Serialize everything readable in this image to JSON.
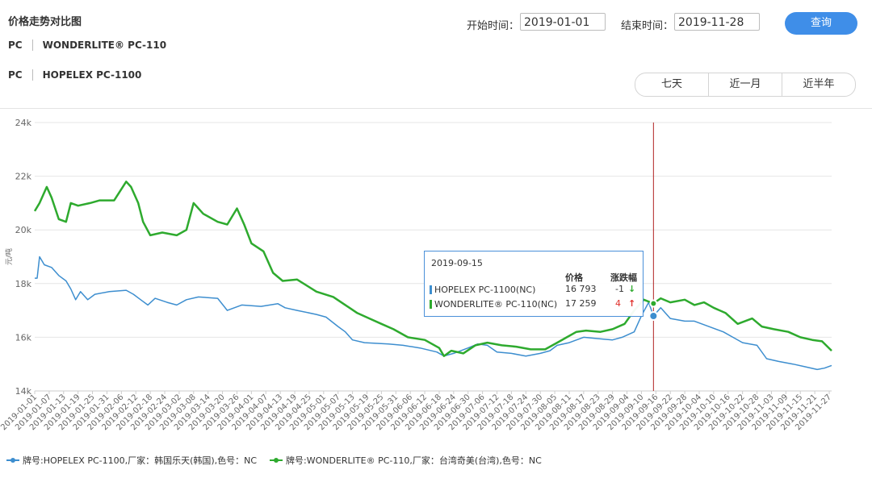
{
  "header": {
    "title": "价格走势对比图",
    "products": [
      {
        "category": "PC",
        "name": "WONDERLITE® PC-110"
      },
      {
        "category": "PC",
        "name": "HOPELEX PC-1100"
      }
    ],
    "start_label": "开始时间：",
    "start_value": "2019-01-01",
    "end_label": "结束时间：",
    "end_value": "2019-11-28",
    "query_label": "查询",
    "ranges": [
      "七天",
      "近一月",
      "近半年"
    ]
  },
  "tooltip": {
    "date": "2019-09-15",
    "col_price": "价格",
    "col_change": "涨跌幅",
    "rows": [
      {
        "name": "HOPELEX PC-1100(NC)",
        "price": "16 793",
        "change": "-1",
        "arrow": "↓"
      },
      {
        "name": "WONDERLITE® PC-110(NC)",
        "price": "17 259",
        "change": "4",
        "arrow": "↑"
      }
    ]
  },
  "legend": [
    "牌号:HOPELEX PC-1100,厂家：韩国乐天(韩国),色号：NC",
    "牌号:WONDERLITE® PC-110,厂家：台湾奇美(台湾),色号：NC"
  ],
  "colors": {
    "blue": "#3d8ecf",
    "green": "#2eaa2e",
    "cursor": "#b22222",
    "button": "#3f8ee8"
  },
  "chart_data": {
    "type": "line",
    "ylabel": "元/吨",
    "ylim": [
      14000,
      24000
    ],
    "yticks": [
      "14k",
      "16k",
      "18k",
      "20k",
      "22k",
      "24k"
    ],
    "xticks": [
      "2019-01-01",
      "2019-01-07",
      "2019-01-13",
      "2019-01-19",
      "2019-01-25",
      "2019-01-31",
      "2019-02-06",
      "2019-02-12",
      "2019-02-18",
      "2019-02-24",
      "2019-03-02",
      "2019-03-08",
      "2019-03-14",
      "2019-03-20",
      "2019-03-26",
      "2019-04-01",
      "2019-04-07",
      "2019-04-13",
      "2019-04-19",
      "2019-04-25",
      "2019-05-01",
      "2019-05-07",
      "2019-05-13",
      "2019-05-19",
      "2019-05-25",
      "2019-05-31",
      "2019-06-06",
      "2019-06-12",
      "2019-06-18",
      "2019-06-24",
      "2019-06-30",
      "2019-07-06",
      "2019-07-12",
      "2019-07-18",
      "2019-07-24",
      "2019-07-30",
      "2019-08-05",
      "2019-08-11",
      "2019-08-17",
      "2019-08-23",
      "2019-08-29",
      "2019-09-04",
      "2019-09-10",
      "2019-09-16",
      "2019-09-22",
      "2019-09-28",
      "2019-10-04",
      "2019-10-10",
      "2019-10-16",
      "2019-10-22",
      "2019-10-28",
      "2019-11-03",
      "2019-11-09",
      "2019-11-15",
      "2019-11-21",
      "2019-11-27"
    ],
    "cursor_date": "2019-09-15",
    "series": [
      {
        "name": "HOPELEX PC-1100",
        "points": [
          [
            "2019-01-01",
            18200
          ],
          [
            "2019-01-02",
            18200
          ],
          [
            "2019-01-03",
            19000
          ],
          [
            "2019-01-05",
            18700
          ],
          [
            "2019-01-08",
            18600
          ],
          [
            "2019-01-11",
            18300
          ],
          [
            "2019-01-14",
            18100
          ],
          [
            "2019-01-16",
            17800
          ],
          [
            "2019-01-18",
            17400
          ],
          [
            "2019-01-20",
            17700
          ],
          [
            "2019-01-23",
            17400
          ],
          [
            "2019-01-26",
            17600
          ],
          [
            "2019-02-01",
            17700
          ],
          [
            "2019-02-08",
            17750
          ],
          [
            "2019-02-11",
            17600
          ],
          [
            "2019-02-14",
            17400
          ],
          [
            "2019-02-17",
            17200
          ],
          [
            "2019-02-20",
            17450
          ],
          [
            "2019-02-25",
            17300
          ],
          [
            "2019-03-01",
            17200
          ],
          [
            "2019-03-05",
            17400
          ],
          [
            "2019-03-10",
            17500
          ],
          [
            "2019-03-18",
            17450
          ],
          [
            "2019-03-22",
            17000
          ],
          [
            "2019-03-28",
            17200
          ],
          [
            "2019-04-05",
            17150
          ],
          [
            "2019-04-12",
            17250
          ],
          [
            "2019-04-15",
            17100
          ],
          [
            "2019-04-20",
            17000
          ],
          [
            "2019-04-28",
            16850
          ],
          [
            "2019-05-02",
            16750
          ],
          [
            "2019-05-07",
            16400
          ],
          [
            "2019-05-10",
            16200
          ],
          [
            "2019-05-13",
            15900
          ],
          [
            "2019-05-18",
            15800
          ],
          [
            "2019-05-28",
            15750
          ],
          [
            "2019-06-03",
            15700
          ],
          [
            "2019-06-10",
            15600
          ],
          [
            "2019-06-17",
            15450
          ],
          [
            "2019-06-20",
            15300
          ],
          [
            "2019-06-24",
            15400
          ],
          [
            "2019-06-30",
            15600
          ],
          [
            "2019-07-04",
            15750
          ],
          [
            "2019-07-08",
            15700
          ],
          [
            "2019-07-12",
            15450
          ],
          [
            "2019-07-18",
            15400
          ],
          [
            "2019-07-24",
            15300
          ],
          [
            "2019-07-30",
            15400
          ],
          [
            "2019-08-03",
            15500
          ],
          [
            "2019-08-06",
            15700
          ],
          [
            "2019-08-11",
            15800
          ],
          [
            "2019-08-17",
            16000
          ],
          [
            "2019-08-23",
            15950
          ],
          [
            "2019-08-29",
            15900
          ],
          [
            "2019-09-02",
            16000
          ],
          [
            "2019-09-07",
            16200
          ],
          [
            "2019-09-10",
            16800
          ],
          [
            "2019-09-13",
            17300
          ],
          [
            "2019-09-15",
            16793
          ],
          [
            "2019-09-18",
            17100
          ],
          [
            "2019-09-22",
            16700
          ],
          [
            "2019-09-28",
            16600
          ],
          [
            "2019-10-02",
            16600
          ],
          [
            "2019-10-08",
            16400
          ],
          [
            "2019-10-14",
            16200
          ],
          [
            "2019-10-18",
            16000
          ],
          [
            "2019-10-22",
            15800
          ],
          [
            "2019-10-28",
            15700
          ],
          [
            "2019-11-01",
            15200
          ],
          [
            "2019-11-06",
            15100
          ],
          [
            "2019-11-12",
            15000
          ],
          [
            "2019-11-17",
            14900
          ],
          [
            "2019-11-22",
            14800
          ],
          [
            "2019-11-25",
            14850
          ],
          [
            "2019-11-28",
            14950
          ]
        ]
      },
      {
        "name": "WONDERLITE® PC-110",
        "points": [
          [
            "2019-01-01",
            20700
          ],
          [
            "2019-01-03",
            21000
          ],
          [
            "2019-01-06",
            21600
          ],
          [
            "2019-01-08",
            21200
          ],
          [
            "2019-01-11",
            20400
          ],
          [
            "2019-01-14",
            20300
          ],
          [
            "2019-01-16",
            21000
          ],
          [
            "2019-01-19",
            20900
          ],
          [
            "2019-01-24",
            21000
          ],
          [
            "2019-01-28",
            21100
          ],
          [
            "2019-02-03",
            21100
          ],
          [
            "2019-02-08",
            21800
          ],
          [
            "2019-02-10",
            21600
          ],
          [
            "2019-02-13",
            21000
          ],
          [
            "2019-02-15",
            20300
          ],
          [
            "2019-02-18",
            19800
          ],
          [
            "2019-02-23",
            19900
          ],
          [
            "2019-03-01",
            19800
          ],
          [
            "2019-03-05",
            20000
          ],
          [
            "2019-03-08",
            21000
          ],
          [
            "2019-03-12",
            20600
          ],
          [
            "2019-03-18",
            20300
          ],
          [
            "2019-03-22",
            20200
          ],
          [
            "2019-03-26",
            20800
          ],
          [
            "2019-03-29",
            20200
          ],
          [
            "2019-04-01",
            19500
          ],
          [
            "2019-04-06",
            19200
          ],
          [
            "2019-04-10",
            18400
          ],
          [
            "2019-04-14",
            18100
          ],
          [
            "2019-04-20",
            18150
          ],
          [
            "2019-04-28",
            17700
          ],
          [
            "2019-05-05",
            17500
          ],
          [
            "2019-05-10",
            17200
          ],
          [
            "2019-05-15",
            16900
          ],
          [
            "2019-05-20",
            16700
          ],
          [
            "2019-05-25",
            16500
          ],
          [
            "2019-05-30",
            16300
          ],
          [
            "2019-06-05",
            16000
          ],
          [
            "2019-06-12",
            15900
          ],
          [
            "2019-06-18",
            15600
          ],
          [
            "2019-06-20",
            15300
          ],
          [
            "2019-06-23",
            15500
          ],
          [
            "2019-06-28",
            15400
          ],
          [
            "2019-07-03",
            15700
          ],
          [
            "2019-07-08",
            15800
          ],
          [
            "2019-07-14",
            15700
          ],
          [
            "2019-07-20",
            15650
          ],
          [
            "2019-07-26",
            15550
          ],
          [
            "2019-08-01",
            15550
          ],
          [
            "2019-08-06",
            15800
          ],
          [
            "2019-08-10",
            16000
          ],
          [
            "2019-08-14",
            16200
          ],
          [
            "2019-08-18",
            16250
          ],
          [
            "2019-08-24",
            16200
          ],
          [
            "2019-08-29",
            16300
          ],
          [
            "2019-09-03",
            16500
          ],
          [
            "2019-09-07",
            17000
          ],
          [
            "2019-09-11",
            17400
          ],
          [
            "2019-09-15",
            17259
          ],
          [
            "2019-09-18",
            17450
          ],
          [
            "2019-09-22",
            17300
          ],
          [
            "2019-09-28",
            17400
          ],
          [
            "2019-10-02",
            17200
          ],
          [
            "2019-10-06",
            17300
          ],
          [
            "2019-10-10",
            17100
          ],
          [
            "2019-10-15",
            16900
          ],
          [
            "2019-10-20",
            16500
          ],
          [
            "2019-10-26",
            16700
          ],
          [
            "2019-10-30",
            16400
          ],
          [
            "2019-11-04",
            16300
          ],
          [
            "2019-11-10",
            16200
          ],
          [
            "2019-11-15",
            16000
          ],
          [
            "2019-11-20",
            15900
          ],
          [
            "2019-11-24",
            15850
          ],
          [
            "2019-11-28",
            15500
          ]
        ]
      }
    ]
  }
}
